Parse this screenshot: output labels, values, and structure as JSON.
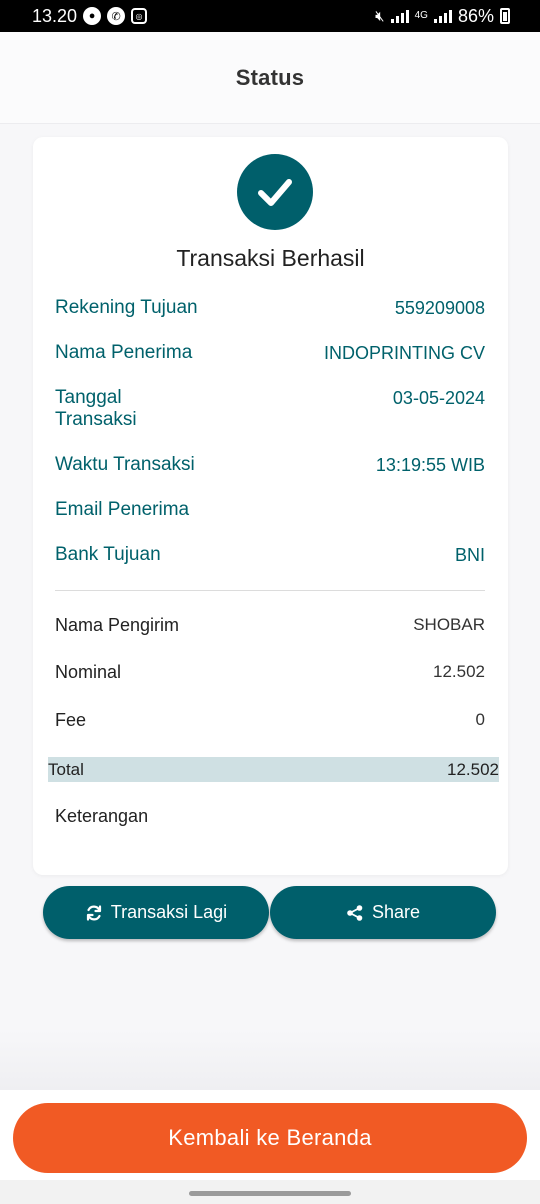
{
  "status_bar": {
    "time": "13.20",
    "network": "4G",
    "battery": "86%"
  },
  "header": {
    "title": "Status"
  },
  "card": {
    "title": "Transaksi Berhasil",
    "details": [
      {
        "label": "Rekening Tujuan",
        "value": "559209008"
      },
      {
        "label": "Nama Penerima",
        "value": "INDOPRINTING CV"
      },
      {
        "label": "Tanggal Transaksi",
        "value": "03-05-2024"
      },
      {
        "label": "Waktu Transaksi",
        "value": "13:19:55 WIB"
      },
      {
        "label": "Email Penerima",
        "value": ""
      },
      {
        "label": "Bank Tujuan",
        "value": "BNI"
      }
    ],
    "summary": {
      "sender_label": "Nama Pengirim",
      "sender_value": "SHOBAR",
      "nominal_label": "Nominal",
      "nominal_value": "12.502",
      "fee_label": "Fee",
      "fee_value": "0",
      "total_label": "Total",
      "total_value": "12.502",
      "note_label": "Keterangan"
    }
  },
  "actions": {
    "repeat_label": "Transaksi Lagi",
    "share_label": "Share",
    "home_label": "Kembali ke Beranda"
  },
  "colors": {
    "primary_teal": "#005f6b",
    "accent_orange": "#f15a24",
    "total_highlight": "#cfe0e3"
  },
  "icons": [
    "check-icon",
    "refresh-icon",
    "share-icon",
    "mute-icon",
    "signal-icon",
    "battery-icon"
  ]
}
